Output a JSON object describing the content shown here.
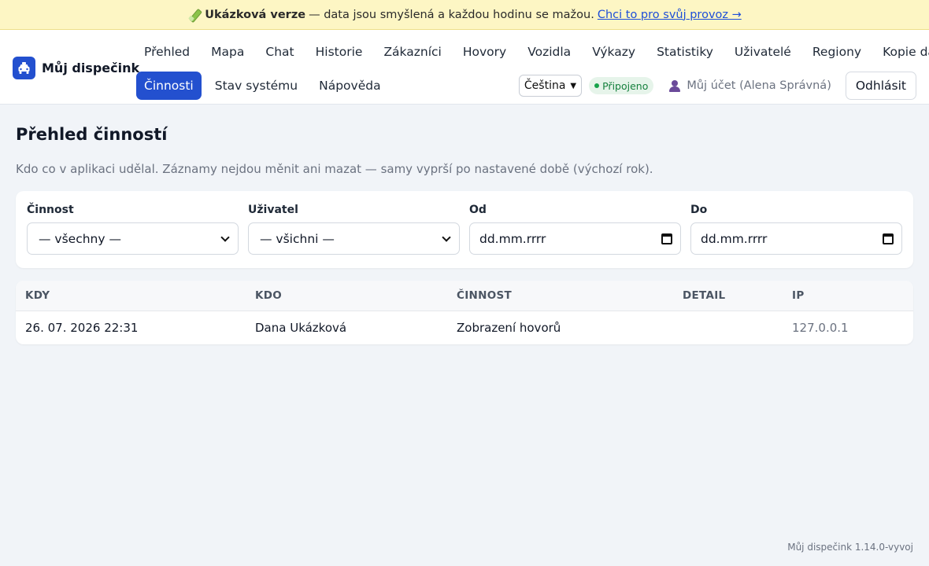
{
  "banner": {
    "label": "Ukázková verze",
    "text": "— data jsou smyšlená a každou hodinu se mažou.",
    "link": "Chci to pro svůj provoz →"
  },
  "brand": {
    "name": "Můj dispečink",
    "icon": "taxi-icon",
    "accent": "#2350cf"
  },
  "nav": {
    "items": [
      {
        "label": "Přehled"
      },
      {
        "label": "Mapa"
      },
      {
        "label": "Chat"
      },
      {
        "label": "Historie"
      },
      {
        "label": "Zákazníci"
      },
      {
        "label": "Hovory"
      },
      {
        "label": "Vozidla"
      },
      {
        "label": "Výkazy"
      },
      {
        "label": "Statistiky"
      },
      {
        "label": "Uživatelé"
      },
      {
        "label": "Regiony"
      },
      {
        "label": "Kopie dat"
      },
      {
        "label": "Činnosti",
        "active": true
      },
      {
        "label": "Stav systému"
      },
      {
        "label": "Nápověda"
      }
    ]
  },
  "header": {
    "language": "Čeština",
    "status": "Připojeno",
    "account": "Můj účet (Alena Správná)",
    "logout": "Odhlásit"
  },
  "page": {
    "title": "Přehled činností",
    "description": "Kdo co v aplikaci udělal. Záznamy nejdou měnit ani mazat — samy vyprší po nastavené době (výchozí rok)."
  },
  "filters": {
    "activity": {
      "label": "Činnost",
      "value": "— všechny —"
    },
    "user": {
      "label": "Uživatel",
      "value": "— všichni —"
    },
    "from": {
      "label": "Od",
      "placeholder": "dd.mm.rrrr"
    },
    "to": {
      "label": "Do",
      "placeholder": "dd.mm.rrrr"
    }
  },
  "table": {
    "columns": [
      "Kdy",
      "Kdo",
      "Činnost",
      "Detail",
      "IP"
    ],
    "rows": [
      {
        "when": "26. 07. 2026 22:31",
        "who": "Dana Ukázková",
        "activity": "Zobrazení hovorů",
        "detail": "",
        "ip": "127.0.0.1"
      }
    ]
  },
  "footer": {
    "version": "Můj dispečink 1.14.0-vyvoj"
  }
}
